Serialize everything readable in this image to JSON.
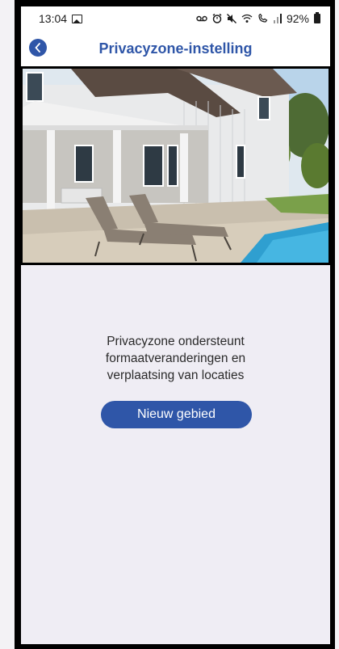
{
  "status_bar": {
    "time": "13:04",
    "battery": "92%",
    "icons": [
      "gallery-icon",
      "voicemail-icon",
      "alarm-icon",
      "mute-icon",
      "wifi-calling-icon",
      "signal-icon",
      "battery-icon"
    ]
  },
  "header": {
    "title": "Privacyzone-instelling",
    "back_icon": "chevron-left-icon",
    "accent_color": "#2f56a8"
  },
  "camera_view": {
    "subject": "house-with-pool-photo"
  },
  "main": {
    "info_line1": "Privacyzone ondersteunt",
    "info_line2": "formaatveranderingen en",
    "info_line3": "verplaatsing van locaties",
    "new_area_button": "Nieuw gebied"
  }
}
